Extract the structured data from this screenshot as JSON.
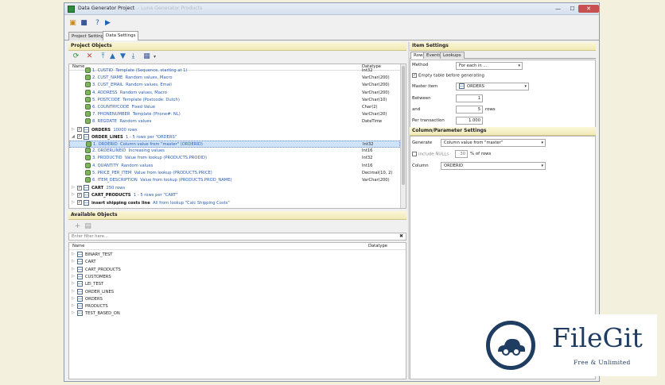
{
  "window": {
    "title": "Data Generator Project",
    "title_ghost": "- Luna Generator Products",
    "minimize": "—",
    "maximize": "☐",
    "close": "✕"
  },
  "tabs": [
    {
      "label": "Project Settings"
    },
    {
      "label": "Data Settings"
    }
  ],
  "project_objects": {
    "header": "Project Objects",
    "col_name": "Name",
    "col_datatype": "Datatype",
    "rows": [
      {
        "label": "1. CUSTID",
        "desc": "Template (Sequence, starting at 1)",
        "type": "Int32"
      },
      {
        "label": "2. CUST_NAME",
        "desc": "Random values, Macro",
        "type": "VarChar(200)"
      },
      {
        "label": "3. CUST_EMAIL",
        "desc": "Random values, Email",
        "type": "VarChar(200)"
      },
      {
        "label": "4. ADDRESS",
        "desc": "Random values, Macro",
        "type": "VarChar(200)"
      },
      {
        "label": "5. POSTCODE",
        "desc": "Template (Postcode: Dutch)",
        "type": "VarChar(10)"
      },
      {
        "label": "6. COUNTRYCODE",
        "desc": "Fixed Value",
        "type": "Char(2)"
      },
      {
        "label": "7. PHONENUMBER",
        "desc": "Template (Phone#: NL)",
        "type": "VarChar(20)"
      },
      {
        "label": "8. REGDATE",
        "desc": "Random values",
        "type": "DateTime"
      },
      {
        "label": "ORDERS",
        "desc": "10000 rows",
        "type": ""
      },
      {
        "label": "ORDER_LINES",
        "desc": "1 - 5 rows per \"ORDERS\"",
        "type": ""
      },
      {
        "label": "1. ORDERID",
        "desc": "Column value from \"master\" (ORDERID)",
        "type": "Int32"
      },
      {
        "label": "2. ORDERLINEID",
        "desc": "Increasing values",
        "type": "Int16"
      },
      {
        "label": "3. PRODUCTID",
        "desc": "Value from lookup (PRODUCTS.PRODID)",
        "type": "Int32"
      },
      {
        "label": "4. QUANTITY",
        "desc": "Random values",
        "type": "Int16"
      },
      {
        "label": "5. PRICE_PER_ITEM",
        "desc": "Value from lookup (PRODUCTS.PRICE)",
        "type": "Decimal(10, 2)"
      },
      {
        "label": "6. ITEM_DESCRIPTION",
        "desc": "Value from lookup (PRODUCTS.PROD_NAME)",
        "type": "VarChar(200)"
      },
      {
        "label": "CART",
        "desc": "250 rows",
        "type": ""
      },
      {
        "label": "CART_PRODUCTS",
        "desc": "1 - 5 rows per \"CART\"",
        "type": ""
      },
      {
        "label": "insert shipping costs line",
        "desc": "All from lookup \"Calc Shipping Costs\"",
        "type": ""
      }
    ]
  },
  "available_objects": {
    "header": "Available Objects",
    "filter_placeholder": "Enter filter here...",
    "clear": "✖",
    "col_name": "Name",
    "col_datatype": "Datatype",
    "items": [
      "BINARY_TEST",
      "CART",
      "CART_PRODUCTS",
      "CUSTOMERS",
      "LEI_TEST",
      "ORDER_LINES",
      "ORDERS",
      "PRODUCTS",
      "TEST_BASED_ON"
    ]
  },
  "item_settings": {
    "header": "Item Settings",
    "tabs": [
      "Rows",
      "Events",
      "Lookups"
    ],
    "method_label": "Method",
    "method_value": "For each in ...",
    "empty_table_label": "Empty table before generating",
    "master_label": "Master item",
    "master_value": "ORDERS",
    "between_label": "Between",
    "between_value": "1",
    "and_label": "and",
    "and_value": "5",
    "rows_suffix": "rows",
    "per_tx_label": "Per transaction",
    "per_tx_value": "1.000"
  },
  "column_settings": {
    "header": "Column/Parameter Settings",
    "generate_label": "Generate",
    "generate_value": "Column value from \"master\"",
    "include_nulls_label": "Include NULLs",
    "nulls_pct": "30",
    "nulls_suffix": "% of rows",
    "column_label": "Column",
    "column_value": "ORDERID"
  },
  "watermark": {
    "brand": "FileGit",
    "tagline": "Free & Unlimited"
  },
  "colors": {
    "accent_blue": "#2a5db0",
    "header_yellow": "#f1e9b5",
    "brand_navy": "#1f3c61"
  }
}
